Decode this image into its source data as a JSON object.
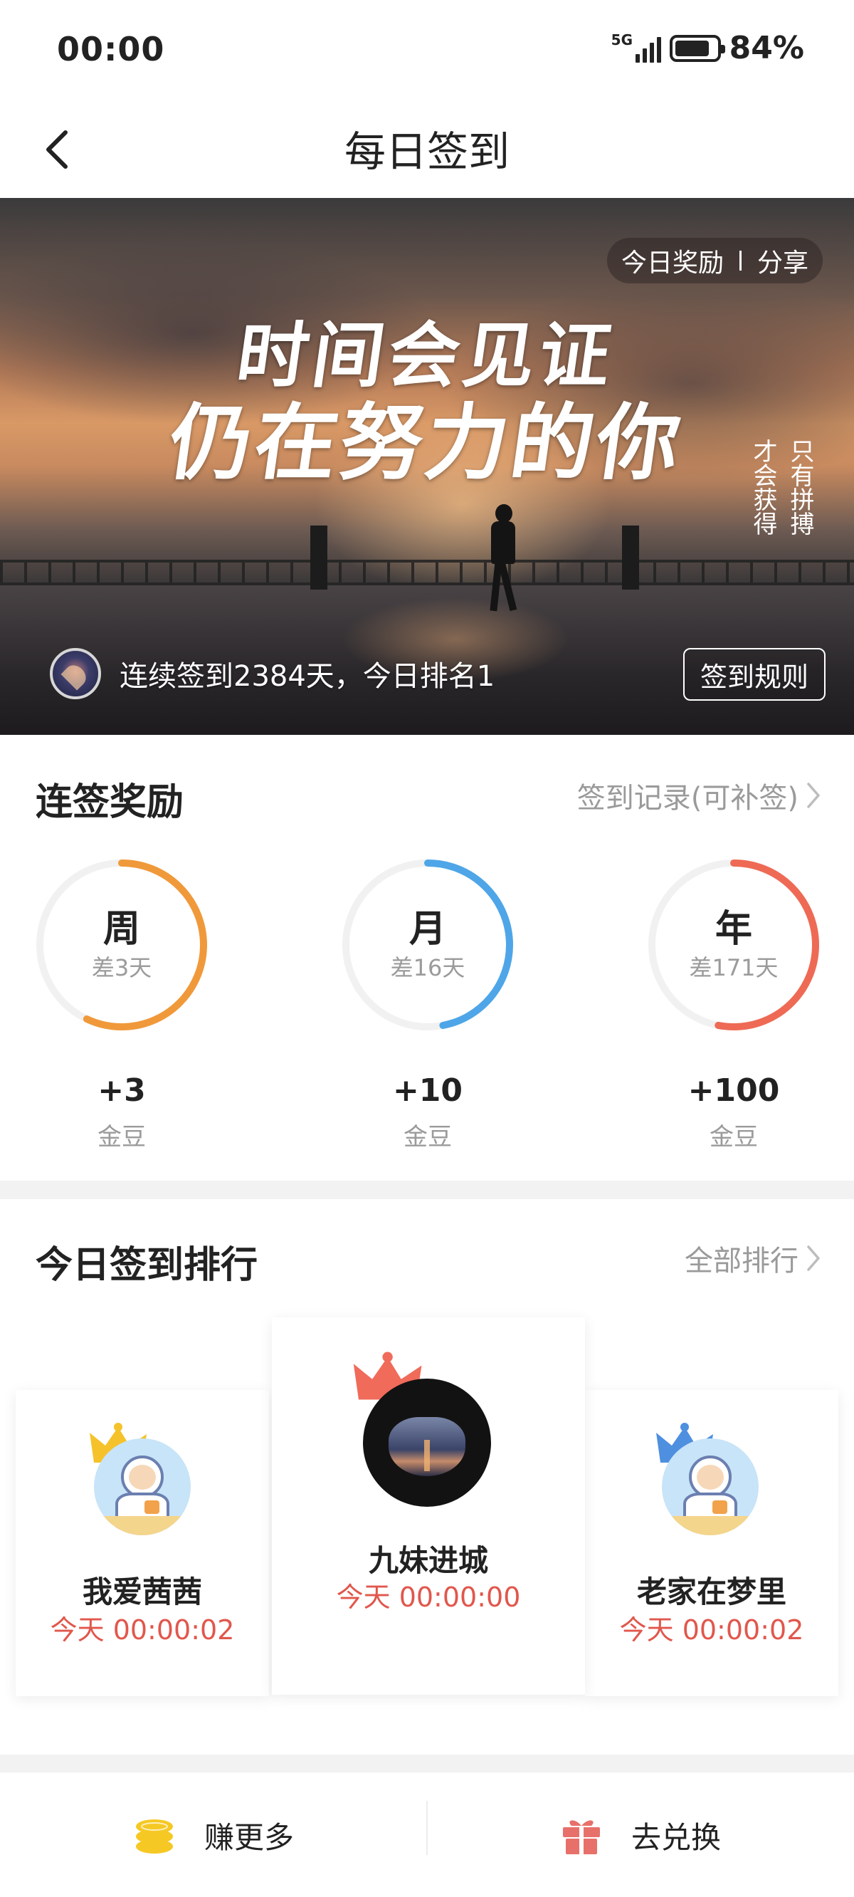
{
  "status_bar": {
    "time": "00:00",
    "network": "5G",
    "battery": "84%"
  },
  "nav": {
    "title": "每日签到"
  },
  "banner": {
    "slogan_line1": "时间会见证",
    "slogan_line2": "仍在努力的你",
    "vertical_right": "只有拼搏",
    "vertical_left": "才会获得",
    "today_reward": "今日奖励",
    "share": "分享",
    "streak_text": "连续签到2384天，今日排名1",
    "rules_button": "签到规则"
  },
  "streak_rewards": {
    "title": "连签奖励",
    "record_link": "签到记录(可补签)",
    "goals": [
      {
        "period": "周",
        "diff": "差3天",
        "amount": "+3",
        "unit": "金豆",
        "color": "#f0993a",
        "progress": 0.57
      },
      {
        "period": "月",
        "diff": "差16天",
        "amount": "+10",
        "unit": "金豆",
        "color": "#4ea6e8",
        "progress": 0.47
      },
      {
        "period": "年",
        "diff": "差171天",
        "amount": "+100",
        "unit": "金豆",
        "color": "#ee6a55",
        "progress": 0.53
      }
    ]
  },
  "ranking": {
    "title": "今日签到排行",
    "all_link": "全部排行",
    "entries": [
      {
        "rank": 2,
        "name": "我爱茜茜",
        "time": "今天 00:00:02",
        "crown_color": "#f5c22b"
      },
      {
        "rank": 1,
        "name": "九妹进城",
        "time": "今天 00:00:00",
        "crown_color": "#f06b5a"
      },
      {
        "rank": 3,
        "name": "老家在梦里",
        "time": "今天 00:00:02",
        "crown_color": "#4e8fe0"
      }
    ]
  },
  "bottom_bar": {
    "earn_more": "赚更多",
    "redeem": "去兑换",
    "earn_icon_color": "#f5c824",
    "redeem_icon_color": "#e8706a"
  }
}
